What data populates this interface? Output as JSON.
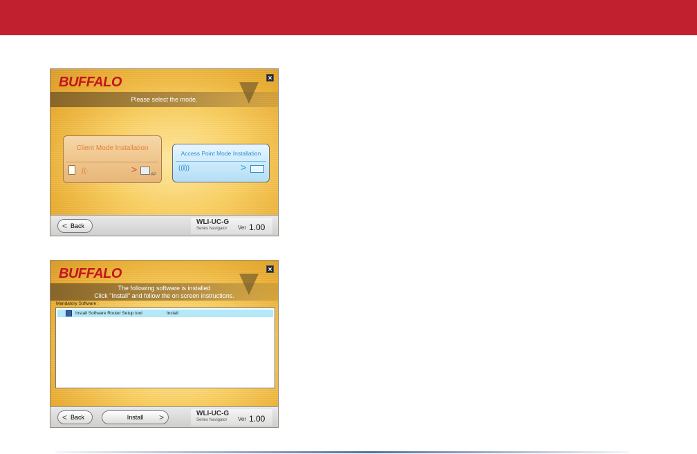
{
  "window1": {
    "brand": "BUFFALO",
    "title": "Please select the mode.",
    "client_mode_label": "Client Mode Installation",
    "ap_mode_label": "Access Point Mode Installation",
    "ap_tag": "AP",
    "back_label": "Back",
    "model": "WLI-UC-G",
    "series": "Series Navigator",
    "ver_label": "Ver",
    "ver_number": "1.00"
  },
  "window2": {
    "brand": "BUFFALO",
    "title_line1": "The following software is installed",
    "title_line2": "Click \"Install\" and follow the on screen instructions.",
    "mandatory_label": "Mandatory Software :",
    "rows": [
      {
        "name": "Install Software Router Setup tool",
        "action": "Install"
      }
    ],
    "back_label": "Back",
    "install_label": "Install",
    "model": "WLI-UC-G",
    "series": "Series Navigator",
    "ver_label": "Ver",
    "ver_number": "1.00"
  },
  "colors": {
    "top_bar": "#c1202e",
    "brand_red": "#c4141f",
    "ap_blue": "#2e8fd0",
    "client_orange": "#e0813a"
  }
}
